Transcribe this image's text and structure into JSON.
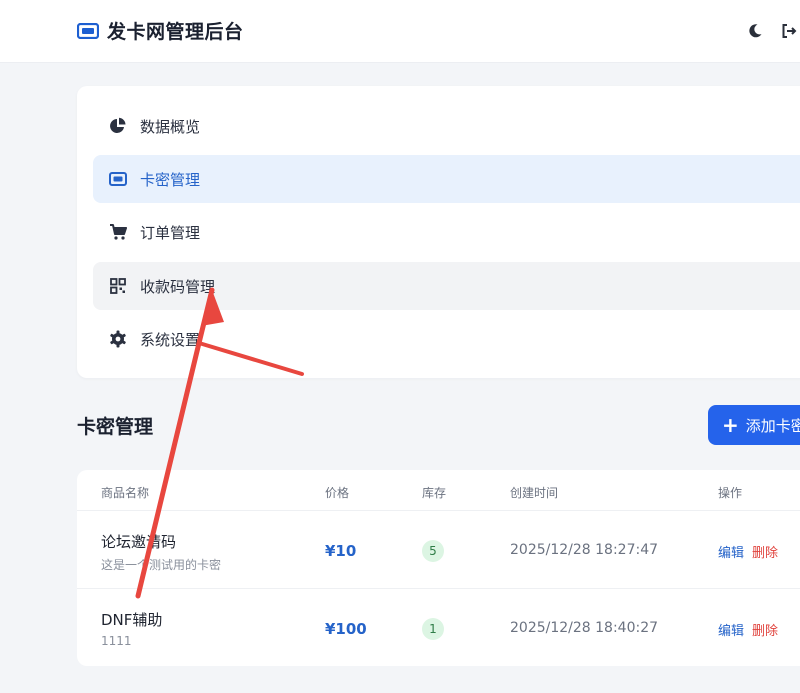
{
  "header": {
    "title": "发卡网管理后台",
    "icons": [
      "ticket-icon",
      "moon-icon",
      "logout-icon"
    ]
  },
  "menu": {
    "items": [
      {
        "label": "数据概览",
        "icon": "pie-chart-icon",
        "state": "normal"
      },
      {
        "label": "卡密管理",
        "icon": "ticket-icon",
        "state": "active"
      },
      {
        "label": "订单管理",
        "icon": "cart-icon",
        "state": "normal"
      },
      {
        "label": "收款码管理",
        "icon": "qrcode-icon",
        "state": "hover"
      },
      {
        "label": "系统设置",
        "icon": "gear-icon",
        "state": "normal"
      }
    ]
  },
  "section": {
    "title": "卡密管理",
    "add_button": "添加卡密"
  },
  "table": {
    "headers": [
      "商品名称",
      "价格",
      "库存",
      "创建时间",
      "操作"
    ],
    "rows": [
      {
        "name": "论坛邀请码",
        "desc": "这是一个测试用的卡密",
        "price": "¥10",
        "stock": "5",
        "created": "2025/12/28 18:27:47",
        "edit": "编辑",
        "delete": "删除"
      },
      {
        "name": "DNF辅助",
        "desc": "1111",
        "price": "¥100",
        "stock": "1",
        "created": "2025/12/28 18:40:27",
        "edit": "编辑",
        "delete": "删除"
      }
    ]
  },
  "colors": {
    "accent": "#2563eb",
    "active_bg": "#e8f1fd",
    "danger": "#e0413b",
    "arrow": "#e8473f"
  }
}
